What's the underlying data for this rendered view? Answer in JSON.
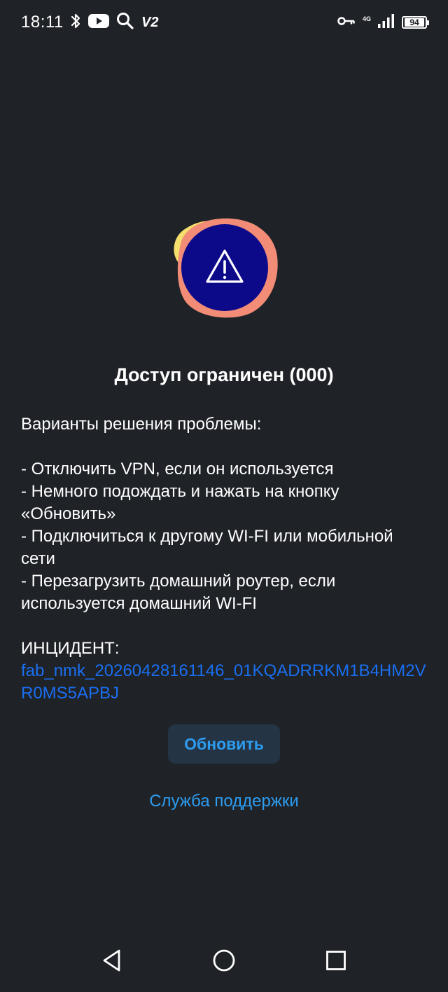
{
  "status_bar": {
    "time": "18:11",
    "left_icons": [
      "bluetooth-icon",
      "youtube-icon",
      "search-icon"
    ],
    "v2_label": "V2",
    "network_type": "4G",
    "battery_level": "94"
  },
  "error": {
    "title": "Доступ ограничен (000)",
    "solutions_header": "Варианты решения проблемы:",
    "solutions": [
      "- Отключить VPN, если он используется",
      "- Немного подождать и нажать на кнопку «Обновить»",
      "- Подключиться к другому WI-FI или мобильной сети",
      "- Перезагрузить домашний роутер, если используется домашний WI-FI"
    ],
    "incident_label": "ИНЦИДЕНТ:",
    "incident_id": "fab_nmk_20260428161146_01KQADRRKM1B4HM2VR0MS5APBJ"
  },
  "actions": {
    "refresh_label": "Обновить",
    "support_label": "Служба поддержки"
  },
  "colors": {
    "background": "#1f2227",
    "accent": "#2d9cf0",
    "link": "#1a6ff0",
    "illustration_circle": "#0d0a8a",
    "illustration_blob_peach": "#f28c76",
    "illustration_blob_yellow": "#f5df6c"
  },
  "nav_bar": {
    "buttons": [
      "back-icon",
      "home-icon",
      "recents-icon"
    ]
  }
}
